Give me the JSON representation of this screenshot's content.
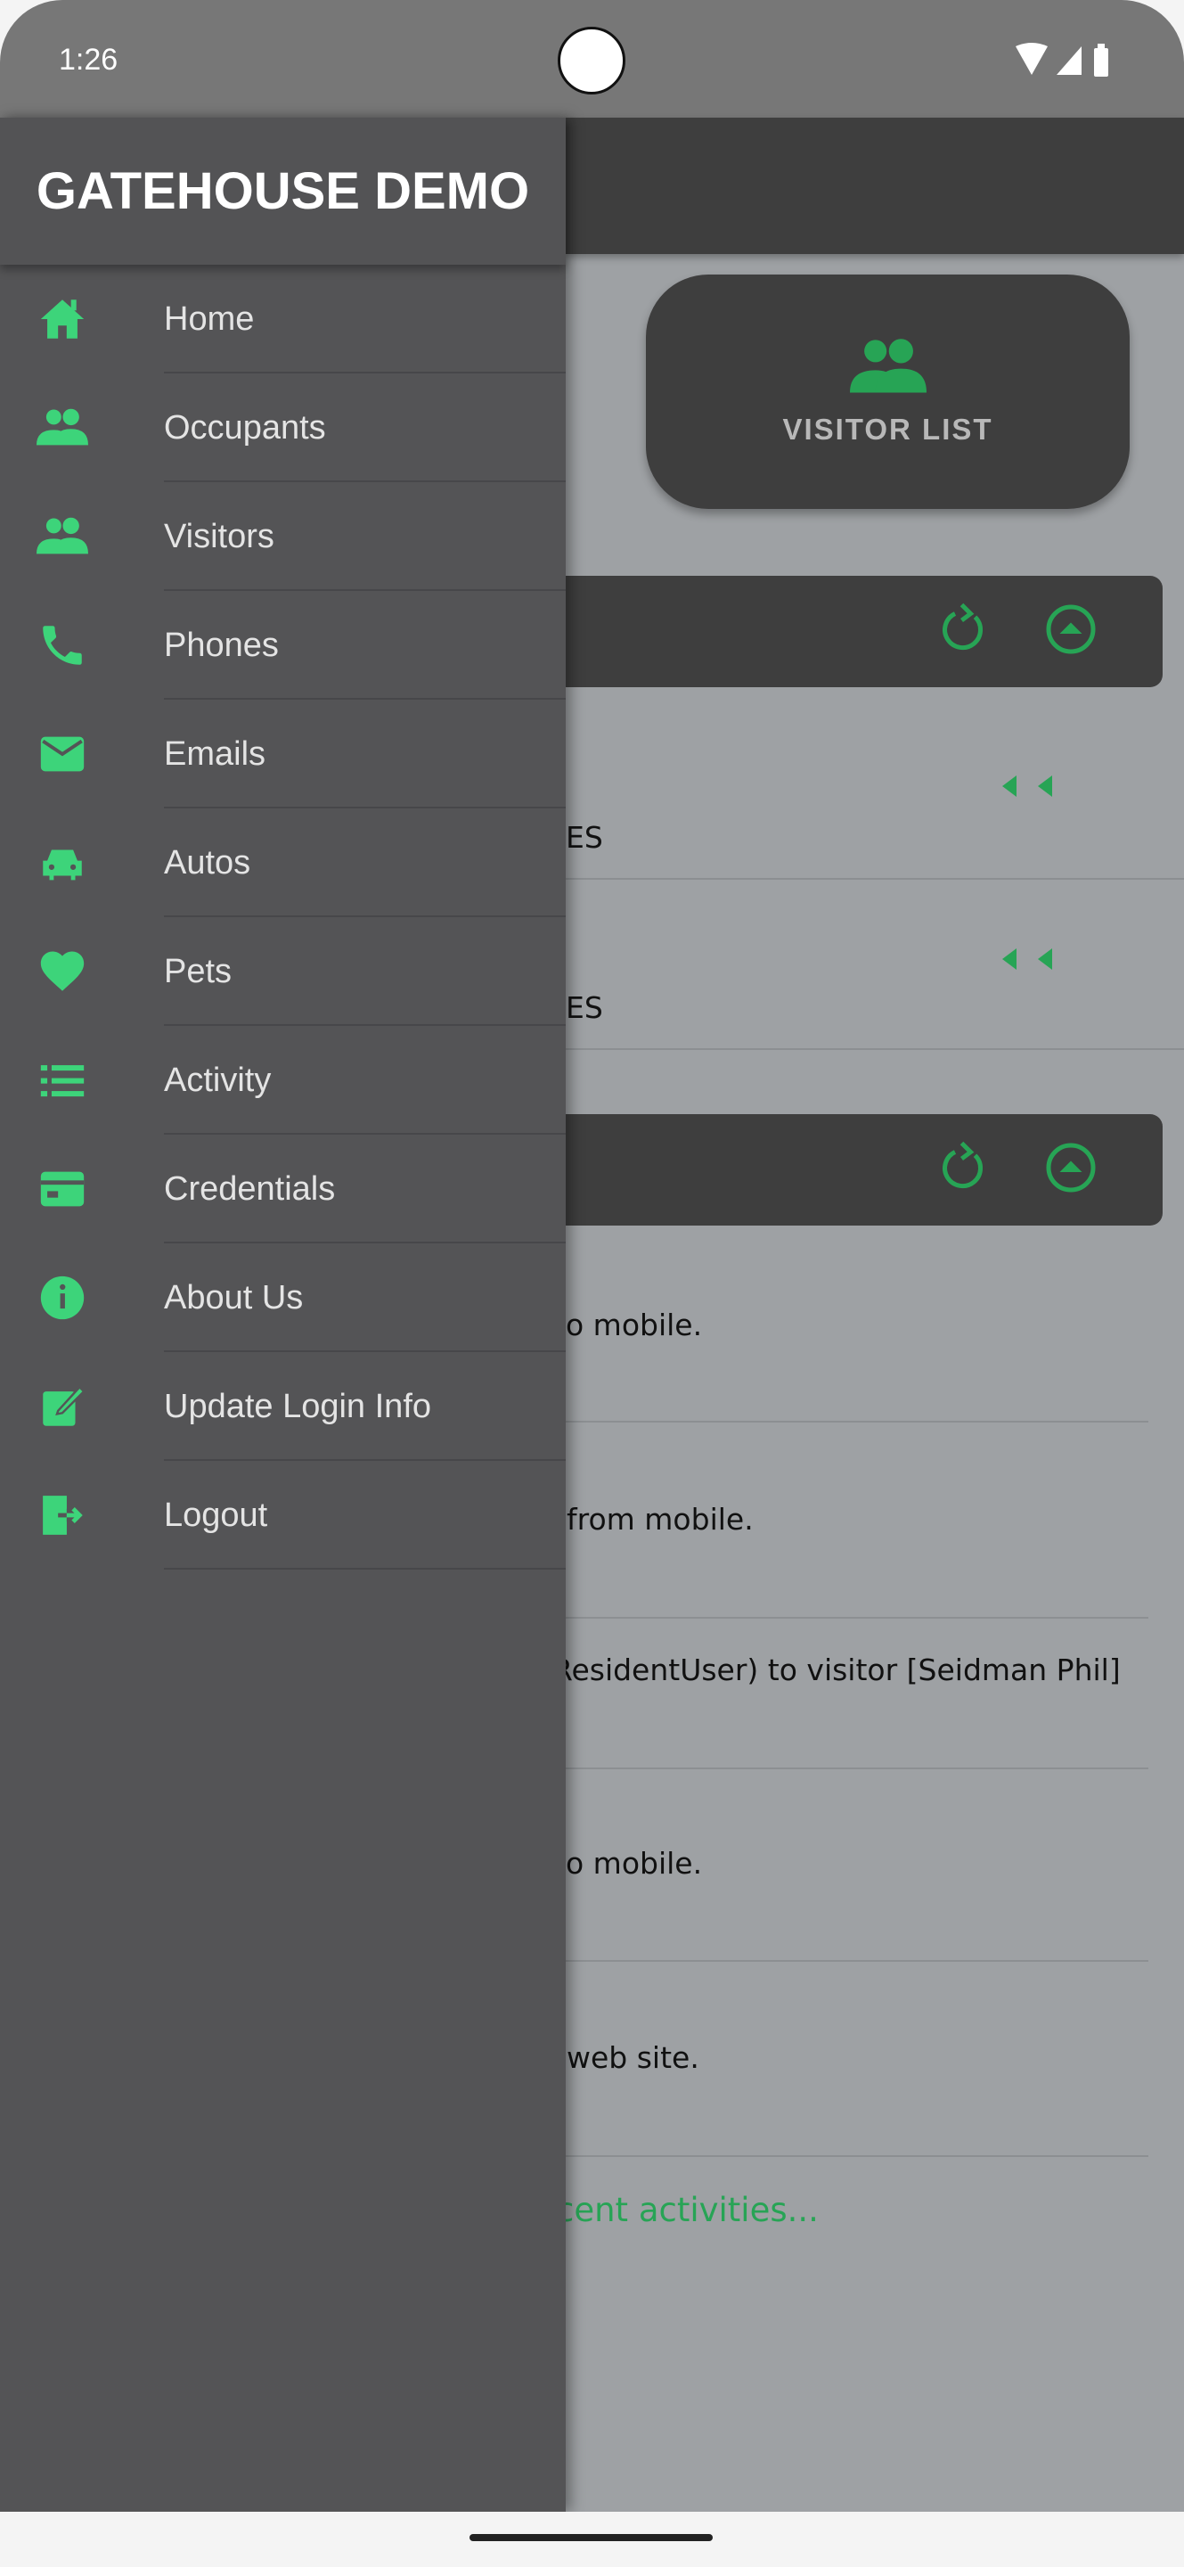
{
  "status_bar": {
    "time": "1:26"
  },
  "colors": {
    "accent": "#3dd47a",
    "accent_dark": "#27a455",
    "drawer_bg": "#545456",
    "appbar": "#3e3e3e"
  },
  "drawer": {
    "title": "GATEHOUSE DEMO",
    "items": [
      {
        "label": "Home",
        "icon": "home-icon"
      },
      {
        "label": "Occupants",
        "icon": "people-icon"
      },
      {
        "label": "Visitors",
        "icon": "people-icon"
      },
      {
        "label": "Phones",
        "icon": "phone-icon"
      },
      {
        "label": "Emails",
        "icon": "email-icon"
      },
      {
        "label": "Autos",
        "icon": "car-icon"
      },
      {
        "label": "Pets",
        "icon": "heart-icon"
      },
      {
        "label": "Activity",
        "icon": "list-icon"
      },
      {
        "label": "Credentials",
        "icon": "card-icon"
      },
      {
        "label": "About Us",
        "icon": "info-icon"
      },
      {
        "label": "Update Login Info",
        "icon": "edit-icon"
      },
      {
        "label": "Logout",
        "icon": "logout-icon"
      }
    ]
  },
  "main": {
    "visitor_button": "VISITOR LIST",
    "list_rows": [
      "ES",
      "ES"
    ],
    "activity_rows": [
      "o mobile.",
      "from mobile.",
      "ResidentUser) to visitor [Seidman Phil]",
      "o mobile.",
      "web site."
    ],
    "more_link": "cent activities..."
  }
}
